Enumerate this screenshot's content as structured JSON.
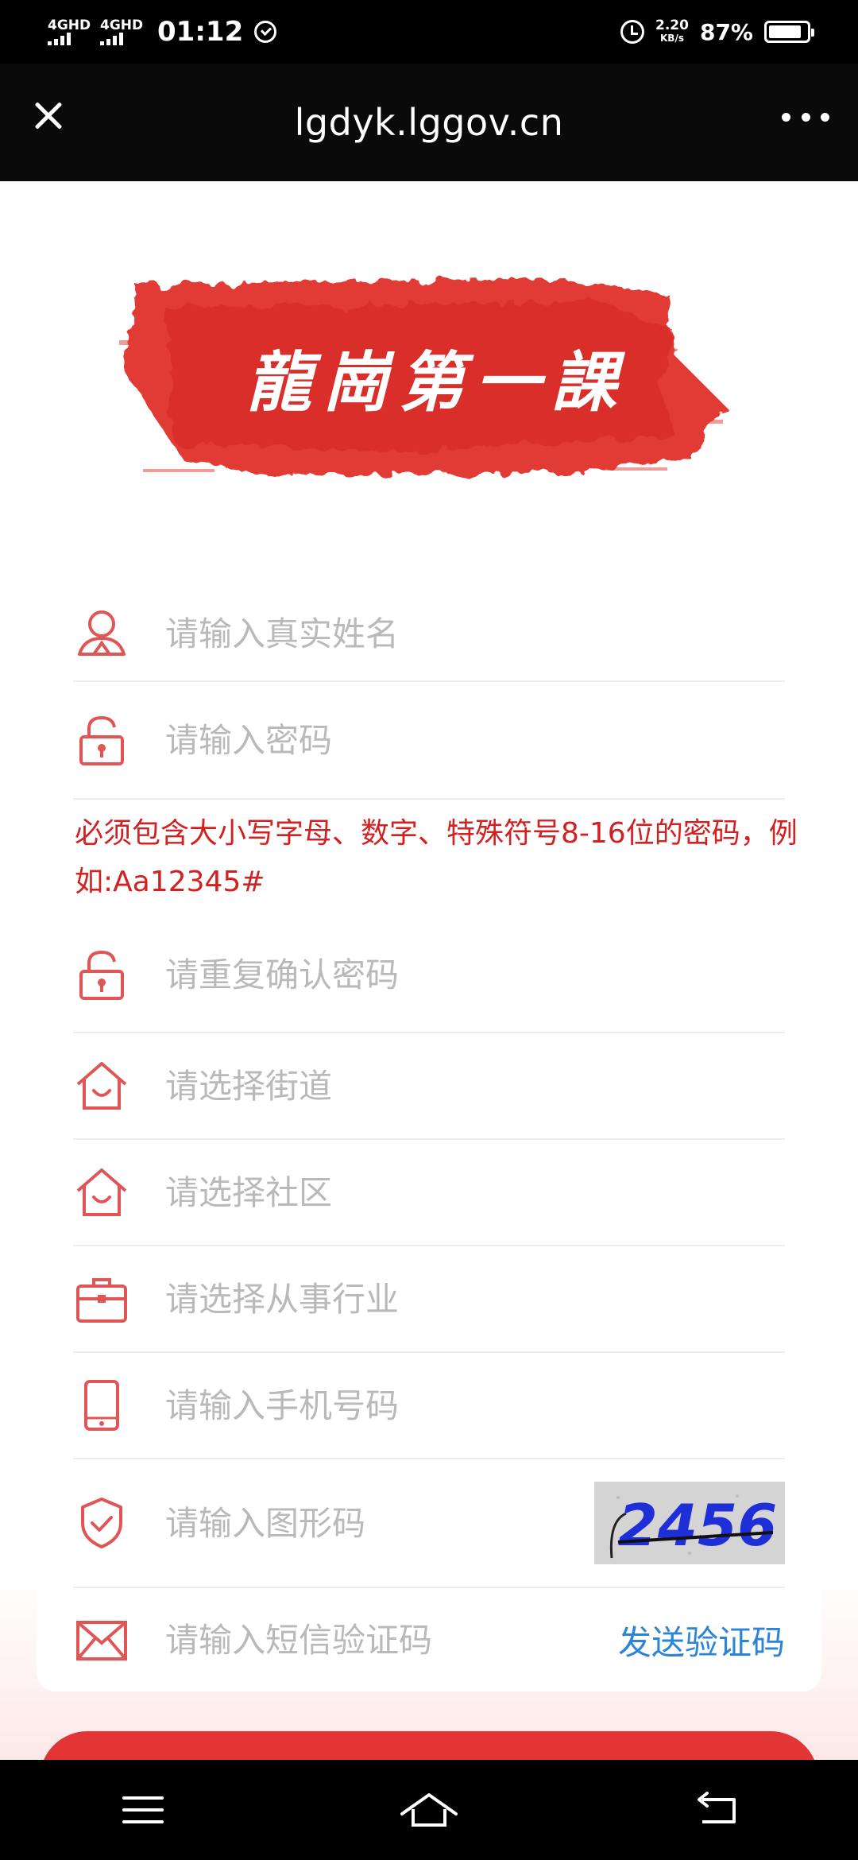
{
  "status_bar": {
    "network_1": "4GHD",
    "network_2": "4GHD",
    "time": "01:12",
    "speed_value": "2.20",
    "speed_unit": "KB/s",
    "battery_percent": "87%",
    "battery_level": 0.87
  },
  "title_bar": {
    "title": "lgdyk.lggov.cn"
  },
  "logo": {
    "text": "龍崗第一課"
  },
  "form": {
    "name_placeholder": "请输入真实姓名",
    "password_placeholder": "请输入密码",
    "password_hint": "必须包含大小写字母、数字、特殊符号8-16位的密码，例如:Aa12345#",
    "confirm_password_placeholder": "请重复确认密码",
    "street_placeholder": "请选择街道",
    "community_placeholder": "请选择社区",
    "industry_placeholder": "请选择从事行业",
    "phone_placeholder": "请输入手机号码",
    "captcha_placeholder": "请输入图形码",
    "captcha_code": "2456",
    "sms_placeholder": "请输入短信验证码",
    "send_code_label": "发送验证码"
  },
  "colors": {
    "accent_red": "#e33535",
    "icon_red": "#e05656",
    "link_blue": "#2b84d8"
  },
  "icons": {
    "close": "close-icon",
    "more": "more-icon",
    "user": "user-icon",
    "lock": "lock-icon",
    "house": "house-icon",
    "briefcase": "briefcase-icon",
    "phone": "phone-icon",
    "shield": "shield-icon",
    "mail": "mail-icon"
  }
}
